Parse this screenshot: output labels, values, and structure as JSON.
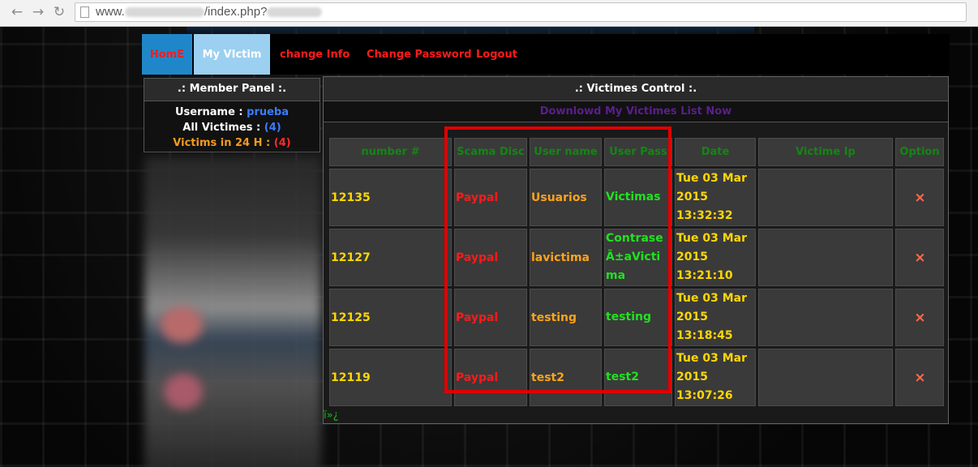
{
  "browser": {
    "url_prefix": "www.",
    "url_middle": "/index.php?"
  },
  "nav": {
    "items": [
      {
        "label": "HomE"
      },
      {
        "label": "My VIctim"
      },
      {
        "label": "change Info"
      },
      {
        "label": "Change Password"
      },
      {
        "label": "Logout"
      }
    ]
  },
  "member_panel": {
    "title": ".: Member Panel :.",
    "username_label": "Username :",
    "username_value": "prueba",
    "all_victims_label": "All Victimes :",
    "all_victims_value": "(4)",
    "victims_24h_label": "Victims in 24 H :",
    "victims_24h_value": "(4)"
  },
  "victims_control": {
    "title": ".: Victimes Control :.",
    "download_link": "Downlowd My Victimes List Now",
    "columns": [
      "number #",
      "Scama Disc",
      "User name",
      "User Pass",
      "Date",
      "Victime Ip",
      "Option"
    ],
    "rows": [
      {
        "number": "12135",
        "scam": "Paypal",
        "user": "Usuarios",
        "pass": "Victimas",
        "date": "Tue 03 Mar 2015 13:32:32",
        "ip": ""
      },
      {
        "number": "12127",
        "scam": "Paypal",
        "user": "lavictima",
        "pass": "ContraseÃ±aVictima",
        "date": "Tue 03 Mar 2015 13:21:10",
        "ip": ""
      },
      {
        "number": "12125",
        "scam": "Paypal",
        "user": "testing",
        "pass": "testing",
        "date": "Tue 03 Mar 2015 13:18:45",
        "ip": ""
      },
      {
        "number": "12119",
        "scam": "Paypal",
        "user": "test2",
        "pass": "test2",
        "date": "Tue 03 Mar 2015 13:07:26",
        "ip": ""
      }
    ],
    "delete_icon": "×"
  },
  "footer_text": "ï»¿",
  "colors": {
    "home_tab": "#1f87c9",
    "active_tab": "#9bd0f0",
    "nav_text": "#ff1a1a",
    "highlight_box": "#e00000"
  }
}
